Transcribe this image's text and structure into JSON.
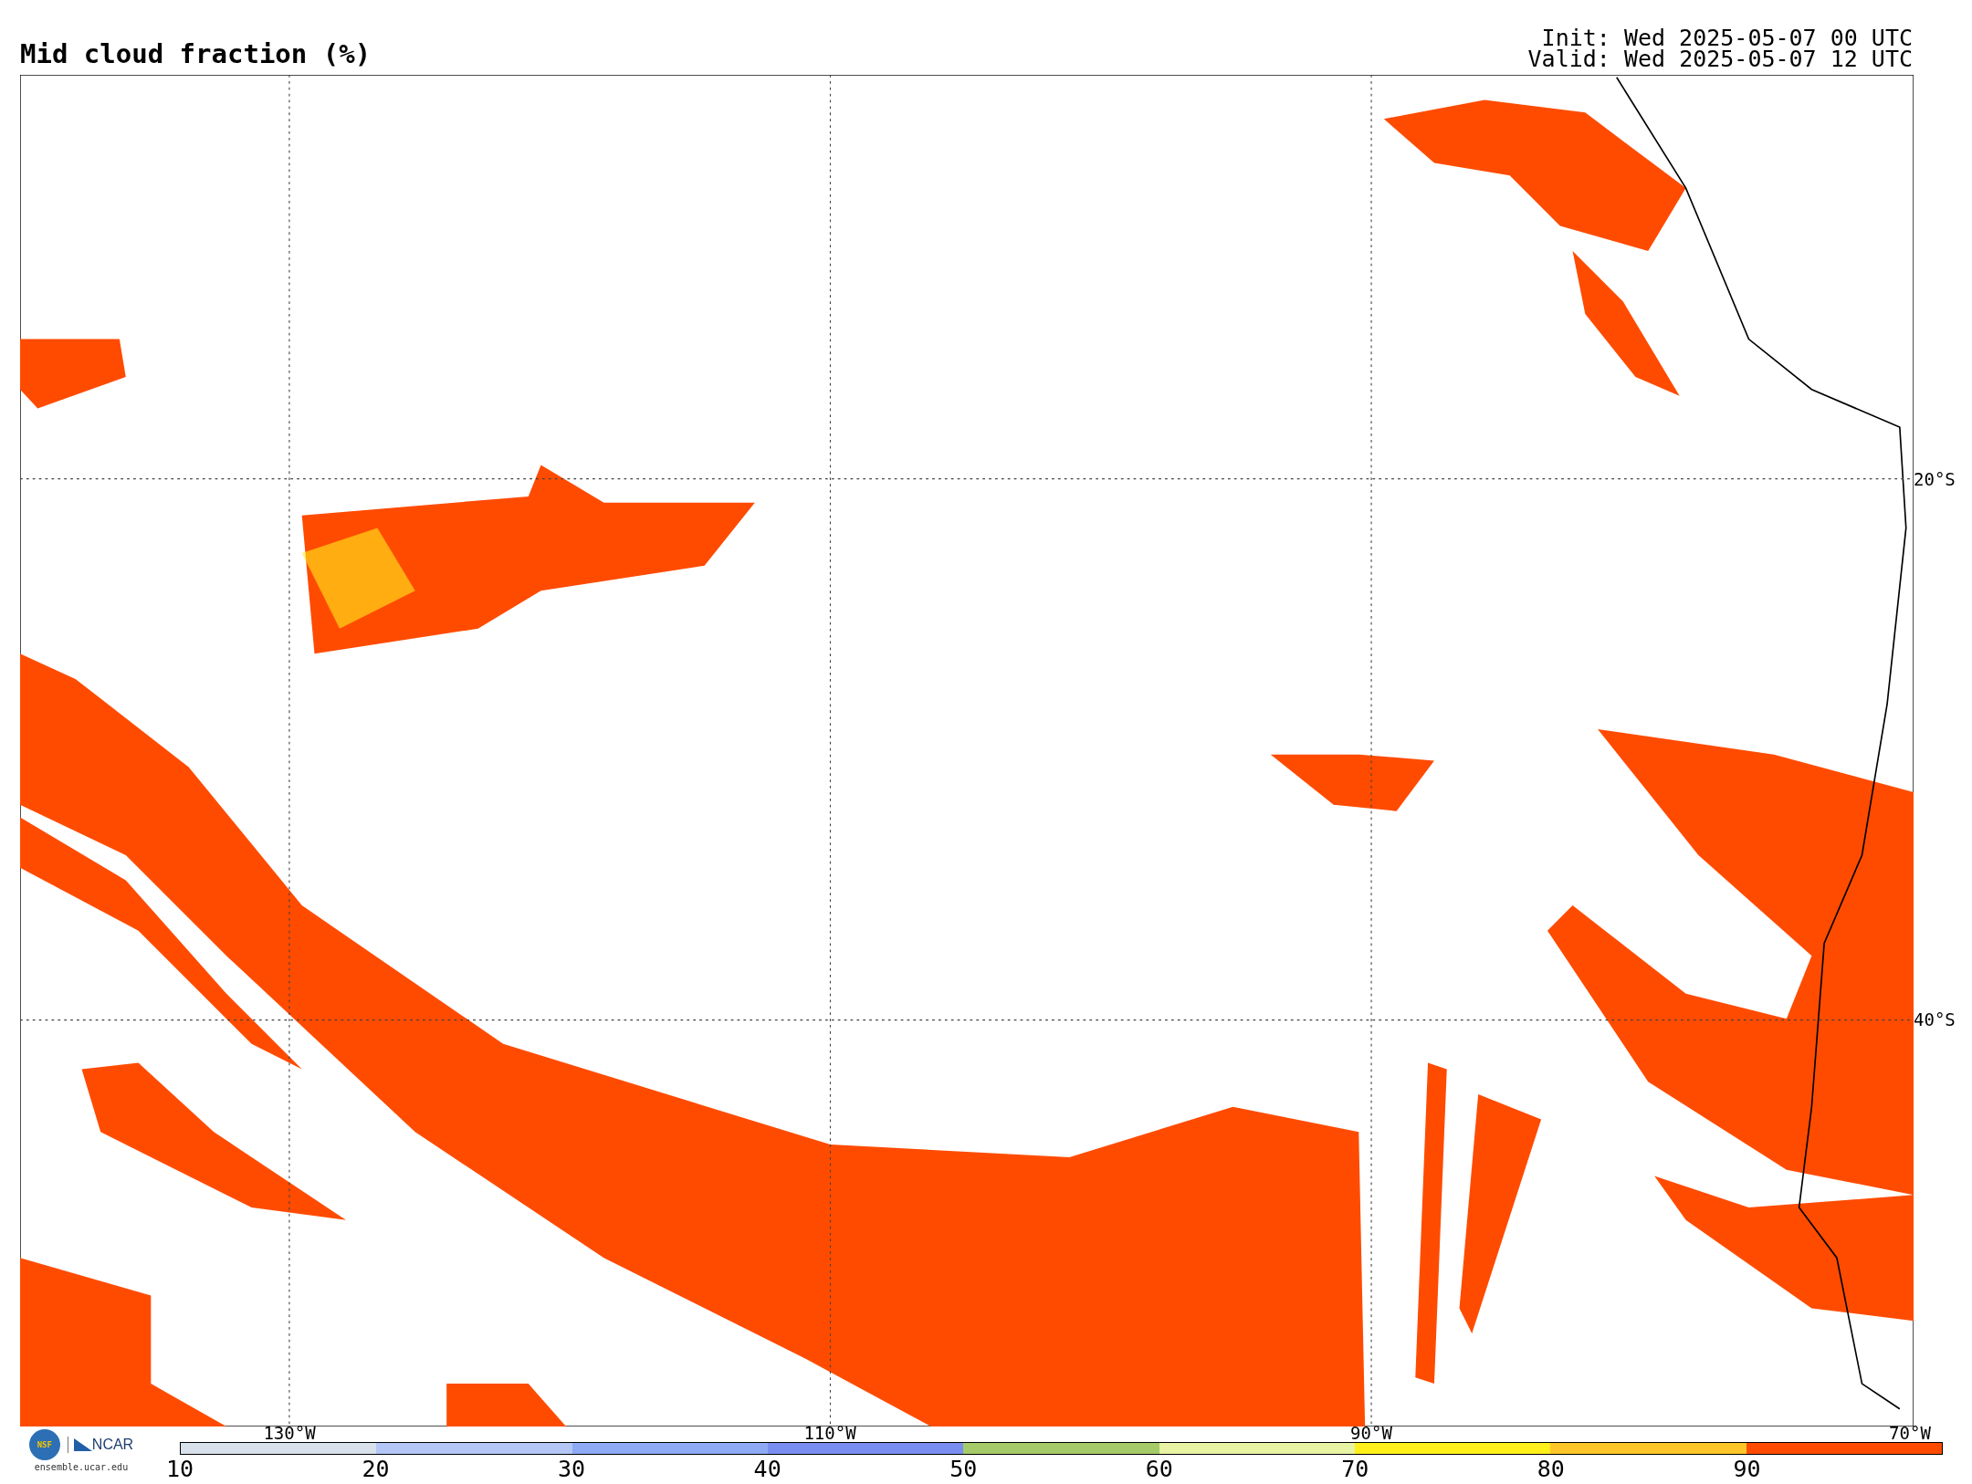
{
  "title": "Mid cloud fraction (%)",
  "run_info": [
    "Init: Wed 2025-05-07 00 UTC",
    "Valid: Wed 2025-05-07 12 UTC"
  ],
  "map": {
    "lat_labels": [
      "20°S",
      "40°S"
    ],
    "lon_labels": [
      "130°W",
      "110°W",
      "90°W",
      "70°W"
    ]
  },
  "logo": {
    "nsf": "NSF",
    "ncar": "NCAR",
    "site": "ensemble.ucar.edu"
  },
  "colorbar": {
    "segments": [
      {
        "color": "#d8e1eb"
      },
      {
        "color": "#b3c6f5"
      },
      {
        "color": "#8eaaf4"
      },
      {
        "color": "#7a8ef0"
      },
      {
        "color": "#a5cb68"
      },
      {
        "color": "#e8f3a4"
      },
      {
        "color": "#ffef1a"
      },
      {
        "color": "#ffc629"
      },
      {
        "color": "#ff4b00"
      }
    ],
    "labels": [
      "10",
      "20",
      "30",
      "40",
      "50",
      "60",
      "70",
      "80",
      "90"
    ]
  }
}
